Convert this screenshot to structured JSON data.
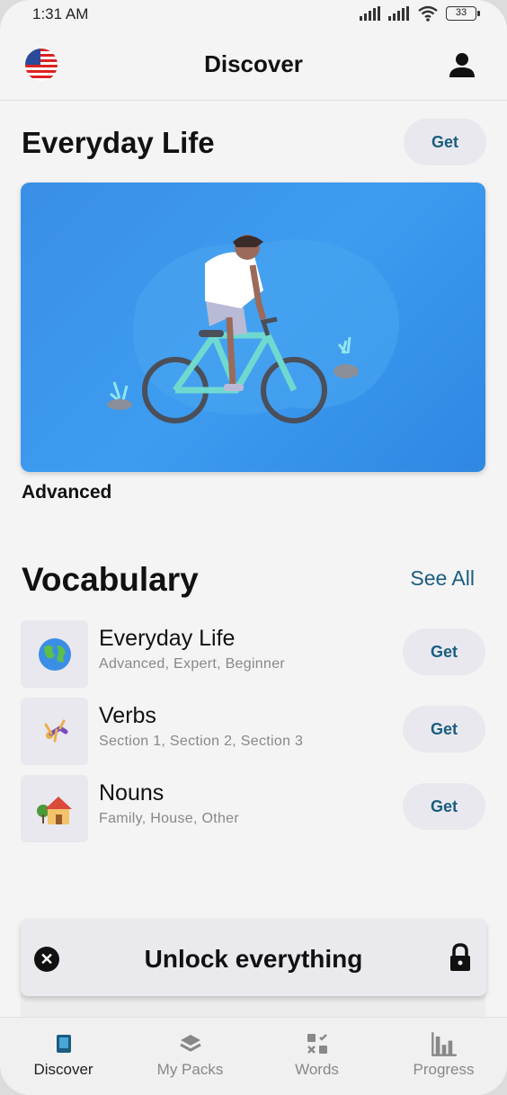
{
  "status_bar": {
    "time": "1:31 AM",
    "battery": "33"
  },
  "header": {
    "title": "Discover",
    "flag_icon": "us-flag-icon",
    "profile_icon": "person-icon"
  },
  "featured": {
    "title": "Everyday Life",
    "get_label": "Get",
    "level": "Advanced"
  },
  "vocabulary": {
    "title": "Vocabulary",
    "see_all": "See All",
    "items": [
      {
        "title": "Everyday Life",
        "subtitle": "Advanced, Expert, Beginner",
        "icon": "globe-icon",
        "get_label": "Get"
      },
      {
        "title": "Verbs",
        "subtitle": "Section 1, Section 2, Section 3",
        "icon": "cartwheel-icon",
        "get_label": "Get"
      },
      {
        "title": "Nouns",
        "subtitle": "Family, House, Other",
        "icon": "house-icon",
        "get_label": "Get"
      }
    ]
  },
  "unlock_banner": {
    "text": "Unlock everything"
  },
  "tabs": [
    {
      "label": "Discover",
      "icon": "book-icon",
      "active": true
    },
    {
      "label": "My Packs",
      "icon": "layers-icon",
      "active": false
    },
    {
      "label": "Words",
      "icon": "grid-icon",
      "active": false
    },
    {
      "label": "Progress",
      "icon": "bar-chart-icon",
      "active": false
    }
  ],
  "colors": {
    "accent": "#1a5d80",
    "hero_blue": "#3d9cf0",
    "pill_bg": "#e8e8ee"
  }
}
